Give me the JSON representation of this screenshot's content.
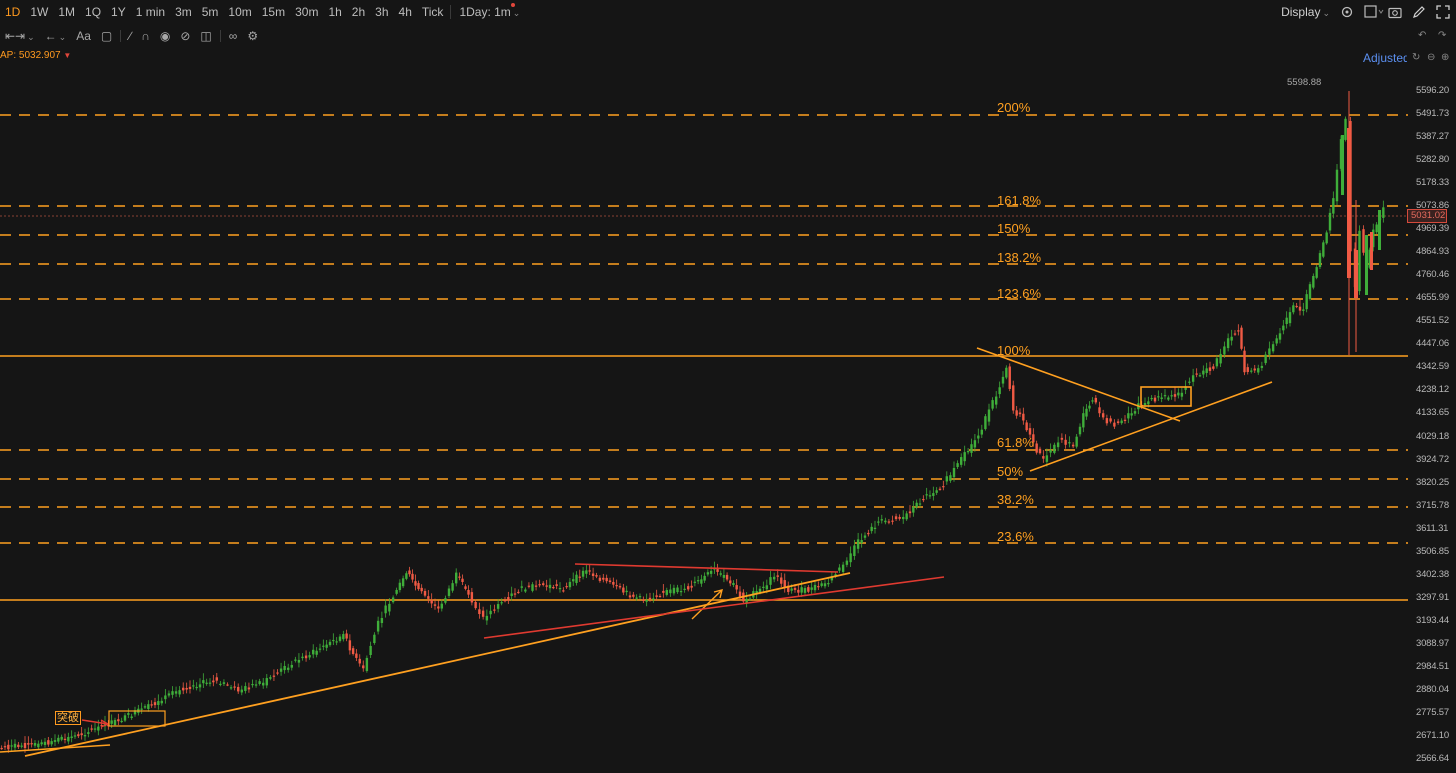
{
  "toolbar": {
    "timeframes": [
      "1D",
      "1W",
      "1M",
      "1Q",
      "1Y",
      "1 min",
      "3m",
      "5m",
      "10m",
      "15m",
      "30m",
      "1h",
      "2h",
      "3h",
      "4h",
      "Tick"
    ],
    "active_timeframe": "1D",
    "interval_select": "1Day: 1m",
    "display_label": "Display"
  },
  "indicator": {
    "label": "AP:",
    "value": "5032.907"
  },
  "adjusted_label": "Adjusted",
  "price_axis": {
    "labels": [
      "5596.20",
      "5491.73",
      "5387.27",
      "5282.80",
      "5178.33",
      "5073.86",
      "4969.39",
      "4864.93",
      "4760.46",
      "4655.99",
      "4551.52",
      "4447.06",
      "4342.59",
      "4238.12",
      "4133.65",
      "4029.18",
      "3924.72",
      "3820.25",
      "3715.78",
      "3611.31",
      "3506.85",
      "3402.38",
      "3297.91",
      "3193.44",
      "3088.97",
      "2984.51",
      "2880.04",
      "2775.57",
      "2671.10",
      "2566.64"
    ],
    "current_price": "5031.02",
    "high_label": "5598.88"
  },
  "fib_levels": [
    "200%",
    "161.8%",
    "150%",
    "138.2%",
    "123.6%",
    "100%",
    "61.8%",
    "50%",
    "38.2%",
    "23.6%"
  ],
  "annotation": {
    "breakout_label": "突破"
  },
  "colors": {
    "up": "#3fae3a",
    "down": "#f05a44",
    "fib_line": "#ffa020",
    "trend_red": "#e03a30",
    "accent": "#ff9a1f"
  }
}
